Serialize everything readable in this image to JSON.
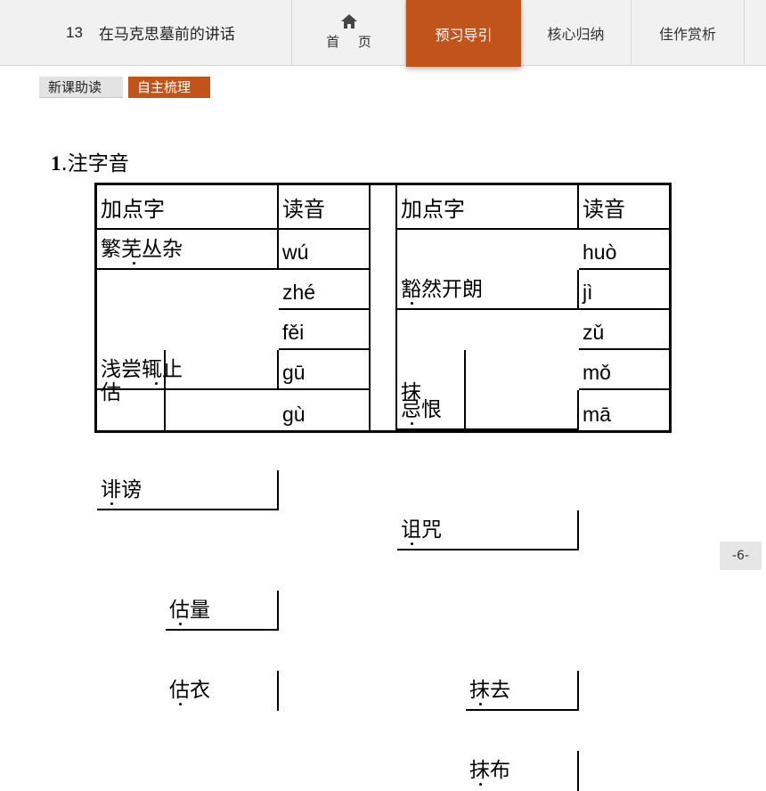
{
  "header": {
    "lesson_number": "13",
    "lesson_title": "在马克思墓前的讲话",
    "nav": {
      "home": "首 页",
      "preview": "预习导引",
      "summary": "核心归纳",
      "appreciate": "佳作赏析"
    }
  },
  "subtabs": [
    "新课助读",
    "自主梳理"
  ],
  "section": {
    "number": "1",
    "title": ".注字音"
  },
  "table": {
    "headers": [
      "加点字",
      "读音",
      "加点字",
      "读音"
    ],
    "rows": [
      {
        "left_word": "繁芜丛杂",
        "left_pinyin": "wú",
        "right_word": "豁然开朗",
        "right_pinyin": "huò"
      },
      {
        "left_word": "浅尝辄止",
        "left_pinyin": "zhé",
        "right_word": "忌恨",
        "right_pinyin": "jì"
      },
      {
        "left_word": "诽谤",
        "left_pinyin": "fěi",
        "right_word": "诅咒",
        "right_pinyin": "zǔ"
      }
    ],
    "groups": [
      {
        "char": "估",
        "items": [
          {
            "word": "估量",
            "pinyin": "gū"
          },
          {
            "word": "估衣",
            "pinyin": "gù"
          }
        ]
      },
      {
        "char": "抹",
        "items": [
          {
            "word": "抹去",
            "pinyin": "mǒ"
          },
          {
            "word": "抹布",
            "pinyin": "mā"
          }
        ]
      }
    ]
  },
  "page_number": "-6-"
}
